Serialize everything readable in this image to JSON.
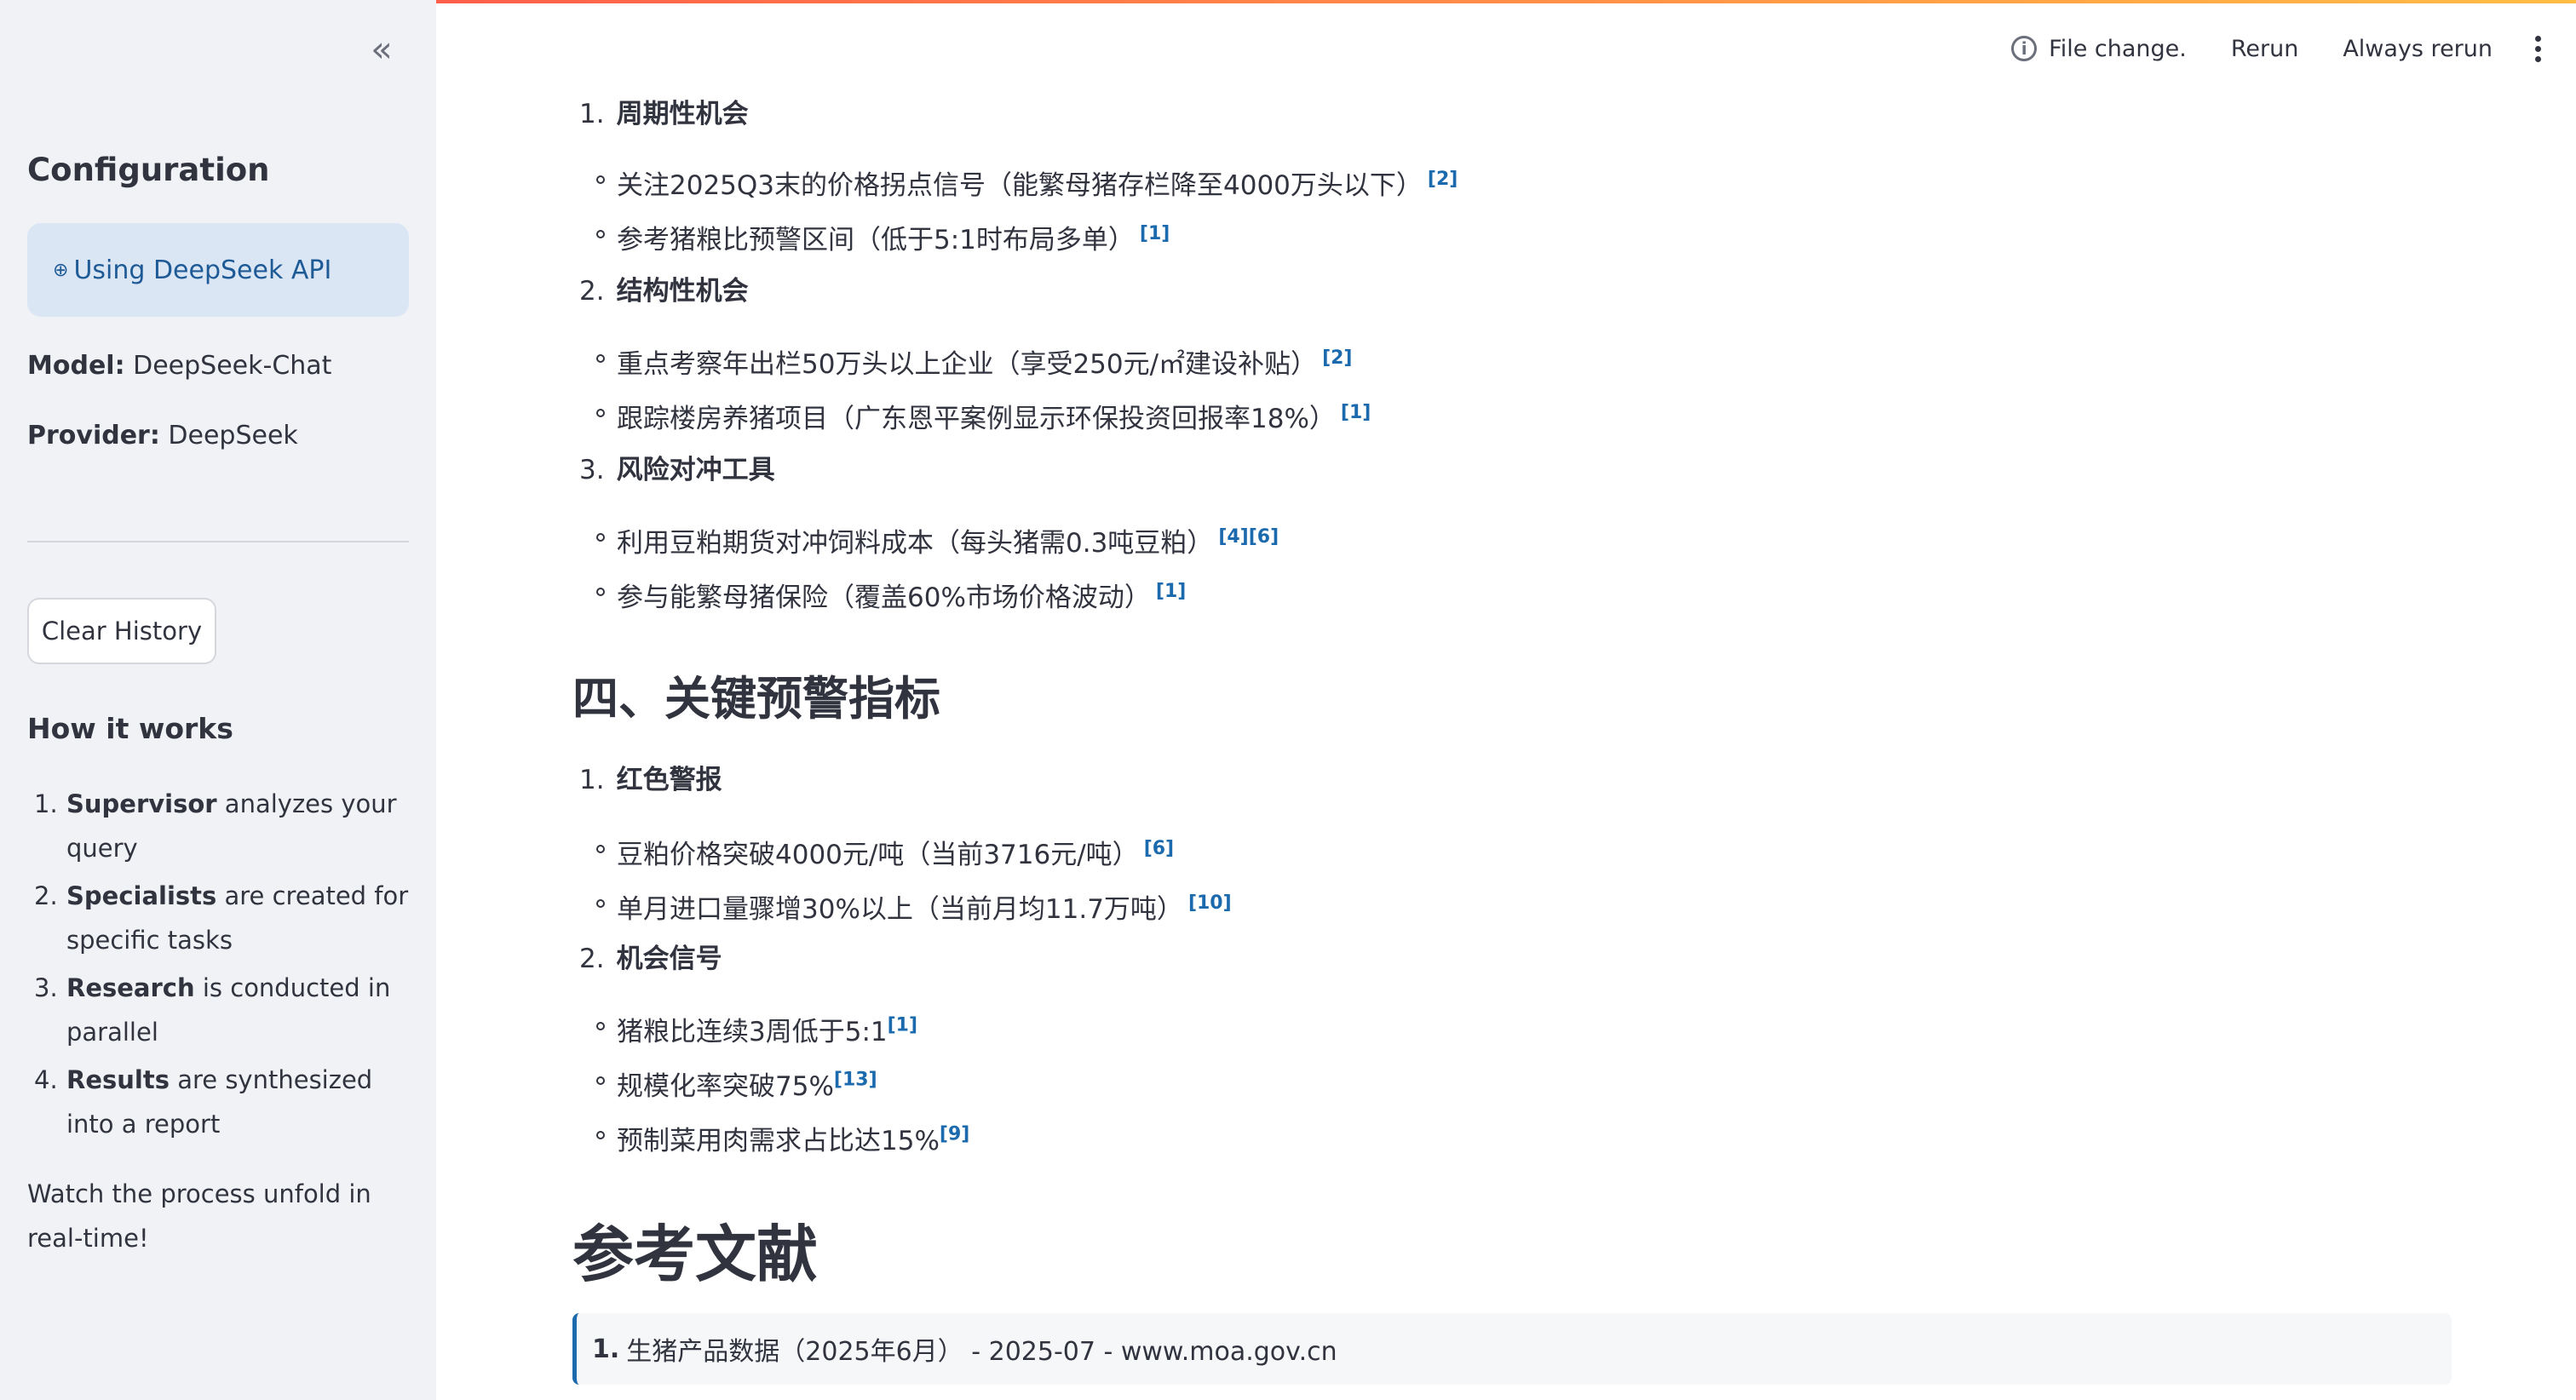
{
  "sidebar": {
    "title": "Configuration",
    "api_notice": "Using DeepSeek API",
    "model_label": "Model:",
    "model_value": "DeepSeek-Chat",
    "provider_label": "Provider:",
    "provider_value": "DeepSeek",
    "clear_button": "Clear History",
    "how_title": "How it works",
    "how_steps": [
      {
        "num": "1.",
        "bold": "Supervisor",
        "rest": " analyzes your query"
      },
      {
        "num": "2.",
        "bold": "Specialists",
        "rest": " are created for specific tasks"
      },
      {
        "num": "3.",
        "bold": "Research",
        "rest": " is conducted in parallel"
      },
      {
        "num": "4.",
        "bold": "Results",
        "rest": " are synthesized into a report"
      }
    ],
    "watch_text": "Watch the process unfold in real-time!"
  },
  "header": {
    "status": "File change.",
    "rerun": "Rerun",
    "always_rerun": "Always rerun"
  },
  "content": {
    "section3_items": [
      {
        "num": "1.",
        "title": "周期性机会",
        "bullets": [
          {
            "text": "关注2025Q3末的价格拐点信号（能繁母猪存栏降至4000万头以下）",
            "cites": "[2]"
          },
          {
            "text": "参考猪粮比预警区间（低于5:1时布局多单）",
            "cites": "[1]"
          }
        ]
      },
      {
        "num": "2.",
        "title": "结构性机会",
        "bullets": [
          {
            "text": "重点考察年出栏50万头以上企业（享受250元/㎡建设补贴）",
            "cites": "[2]"
          },
          {
            "text": "跟踪楼房养猪项目（广东恩平案例显示环保投资回报率18%）",
            "cites": "[1]"
          }
        ]
      },
      {
        "num": "3.",
        "title": "风险对冲工具",
        "bullets": [
          {
            "text": "利用豆粕期货对冲饲料成本（每头猪需0.3吨豆粕）",
            "cites": "[4][6]"
          },
          {
            "text": "参与能繁母猪保险（覆盖60%市场价格波动）",
            "cites": "[1]"
          }
        ]
      }
    ],
    "section4_title": "四、关键预警指标",
    "section4_items": [
      {
        "num": "1.",
        "title": "红色警报",
        "bullets": [
          {
            "text": "豆粕价格突破4000元/吨（当前3716元/吨）",
            "cites": "[6]"
          },
          {
            "text": "单月进口量骤增30%以上（当前月均11.7万吨）",
            "cites": "[10]"
          }
        ]
      },
      {
        "num": "2.",
        "title": "机会信号",
        "bullets": [
          {
            "text": "猪粮比连续3周低于5:1",
            "cites": "[1]"
          },
          {
            "text": "规模化率突破75%",
            "cites": "[13]"
          },
          {
            "text": "预制菜用肉需求占比达15%",
            "cites": "[9]"
          }
        ]
      }
    ],
    "references_title": "参考文献",
    "reference_1_num": "1.",
    "reference_1_text": "生猪产品数据（2025年6月） - 2025-07 - www.moa.gov.cn"
  }
}
